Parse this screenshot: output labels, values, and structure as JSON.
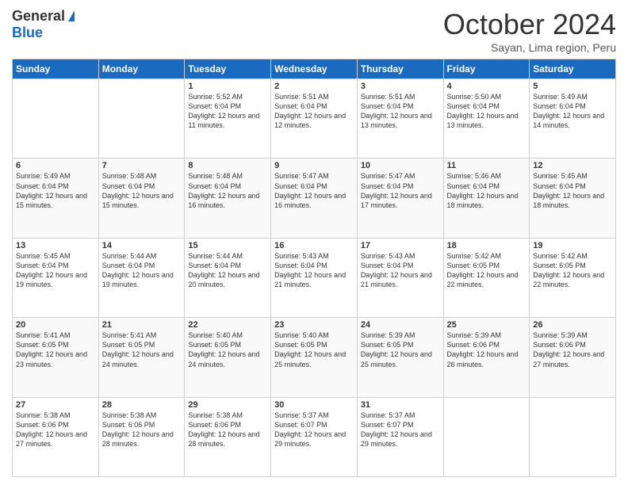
{
  "logo": {
    "general": "General",
    "blue": "Blue"
  },
  "header": {
    "month": "October 2024",
    "location": "Sayan, Lima region, Peru"
  },
  "weekdays": [
    "Sunday",
    "Monday",
    "Tuesday",
    "Wednesday",
    "Thursday",
    "Friday",
    "Saturday"
  ],
  "weeks": [
    [
      {
        "day": "",
        "sunrise": "",
        "sunset": "",
        "daylight": ""
      },
      {
        "day": "",
        "sunrise": "",
        "sunset": "",
        "daylight": ""
      },
      {
        "day": "1",
        "sunrise": "Sunrise: 5:52 AM",
        "sunset": "Sunset: 6:04 PM",
        "daylight": "Daylight: 12 hours and 11 minutes."
      },
      {
        "day": "2",
        "sunrise": "Sunrise: 5:51 AM",
        "sunset": "Sunset: 6:04 PM",
        "daylight": "Daylight: 12 hours and 12 minutes."
      },
      {
        "day": "3",
        "sunrise": "Sunrise: 5:51 AM",
        "sunset": "Sunset: 6:04 PM",
        "daylight": "Daylight: 12 hours and 13 minutes."
      },
      {
        "day": "4",
        "sunrise": "Sunrise: 5:50 AM",
        "sunset": "Sunset: 6:04 PM",
        "daylight": "Daylight: 12 hours and 13 minutes."
      },
      {
        "day": "5",
        "sunrise": "Sunrise: 5:49 AM",
        "sunset": "Sunset: 6:04 PM",
        "daylight": "Daylight: 12 hours and 14 minutes."
      }
    ],
    [
      {
        "day": "6",
        "sunrise": "Sunrise: 5:49 AM",
        "sunset": "Sunset: 6:04 PM",
        "daylight": "Daylight: 12 hours and 15 minutes."
      },
      {
        "day": "7",
        "sunrise": "Sunrise: 5:48 AM",
        "sunset": "Sunset: 6:04 PM",
        "daylight": "Daylight: 12 hours and 15 minutes."
      },
      {
        "day": "8",
        "sunrise": "Sunrise: 5:48 AM",
        "sunset": "Sunset: 6:04 PM",
        "daylight": "Daylight: 12 hours and 16 minutes."
      },
      {
        "day": "9",
        "sunrise": "Sunrise: 5:47 AM",
        "sunset": "Sunset: 6:04 PM",
        "daylight": "Daylight: 12 hours and 16 minutes."
      },
      {
        "day": "10",
        "sunrise": "Sunrise: 5:47 AM",
        "sunset": "Sunset: 6:04 PM",
        "daylight": "Daylight: 12 hours and 17 minutes."
      },
      {
        "day": "11",
        "sunrise": "Sunrise: 5:46 AM",
        "sunset": "Sunset: 6:04 PM",
        "daylight": "Daylight: 12 hours and 18 minutes."
      },
      {
        "day": "12",
        "sunrise": "Sunrise: 5:45 AM",
        "sunset": "Sunset: 6:04 PM",
        "daylight": "Daylight: 12 hours and 18 minutes."
      }
    ],
    [
      {
        "day": "13",
        "sunrise": "Sunrise: 5:45 AM",
        "sunset": "Sunset: 6:04 PM",
        "daylight": "Daylight: 12 hours and 19 minutes."
      },
      {
        "day": "14",
        "sunrise": "Sunrise: 5:44 AM",
        "sunset": "Sunset: 6:04 PM",
        "daylight": "Daylight: 12 hours and 19 minutes."
      },
      {
        "day": "15",
        "sunrise": "Sunrise: 5:44 AM",
        "sunset": "Sunset: 6:04 PM",
        "daylight": "Daylight: 12 hours and 20 minutes."
      },
      {
        "day": "16",
        "sunrise": "Sunrise: 5:43 AM",
        "sunset": "Sunset: 6:04 PM",
        "daylight": "Daylight: 12 hours and 21 minutes."
      },
      {
        "day": "17",
        "sunrise": "Sunrise: 5:43 AM",
        "sunset": "Sunset: 6:04 PM",
        "daylight": "Daylight: 12 hours and 21 minutes."
      },
      {
        "day": "18",
        "sunrise": "Sunrise: 5:42 AM",
        "sunset": "Sunset: 6:05 PM",
        "daylight": "Daylight: 12 hours and 22 minutes."
      },
      {
        "day": "19",
        "sunrise": "Sunrise: 5:42 AM",
        "sunset": "Sunset: 6:05 PM",
        "daylight": "Daylight: 12 hours and 22 minutes."
      }
    ],
    [
      {
        "day": "20",
        "sunrise": "Sunrise: 5:41 AM",
        "sunset": "Sunset: 6:05 PM",
        "daylight": "Daylight: 12 hours and 23 minutes."
      },
      {
        "day": "21",
        "sunrise": "Sunrise: 5:41 AM",
        "sunset": "Sunset: 6:05 PM",
        "daylight": "Daylight: 12 hours and 24 minutes."
      },
      {
        "day": "22",
        "sunrise": "Sunrise: 5:40 AM",
        "sunset": "Sunset: 6:05 PM",
        "daylight": "Daylight: 12 hours and 24 minutes."
      },
      {
        "day": "23",
        "sunrise": "Sunrise: 5:40 AM",
        "sunset": "Sunset: 6:05 PM",
        "daylight": "Daylight: 12 hours and 25 minutes."
      },
      {
        "day": "24",
        "sunrise": "Sunrise: 5:39 AM",
        "sunset": "Sunset: 6:05 PM",
        "daylight": "Daylight: 12 hours and 25 minutes."
      },
      {
        "day": "25",
        "sunrise": "Sunrise: 5:39 AM",
        "sunset": "Sunset: 6:06 PM",
        "daylight": "Daylight: 12 hours and 26 minutes."
      },
      {
        "day": "26",
        "sunrise": "Sunrise: 5:39 AM",
        "sunset": "Sunset: 6:06 PM",
        "daylight": "Daylight: 12 hours and 27 minutes."
      }
    ],
    [
      {
        "day": "27",
        "sunrise": "Sunrise: 5:38 AM",
        "sunset": "Sunset: 6:06 PM",
        "daylight": "Daylight: 12 hours and 27 minutes."
      },
      {
        "day": "28",
        "sunrise": "Sunrise: 5:38 AM",
        "sunset": "Sunset: 6:06 PM",
        "daylight": "Daylight: 12 hours and 28 minutes."
      },
      {
        "day": "29",
        "sunrise": "Sunrise: 5:38 AM",
        "sunset": "Sunset: 6:06 PM",
        "daylight": "Daylight: 12 hours and 28 minutes."
      },
      {
        "day": "30",
        "sunrise": "Sunrise: 5:37 AM",
        "sunset": "Sunset: 6:07 PM",
        "daylight": "Daylight: 12 hours and 29 minutes."
      },
      {
        "day": "31",
        "sunrise": "Sunrise: 5:37 AM",
        "sunset": "Sunset: 6:07 PM",
        "daylight": "Daylight: 12 hours and 29 minutes."
      },
      {
        "day": "",
        "sunrise": "",
        "sunset": "",
        "daylight": ""
      },
      {
        "day": "",
        "sunrise": "",
        "sunset": "",
        "daylight": ""
      }
    ]
  ]
}
